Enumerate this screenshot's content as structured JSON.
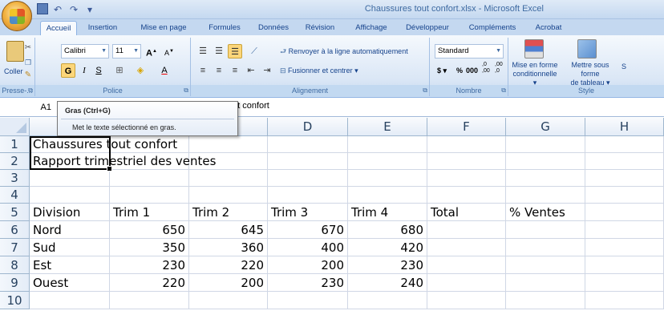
{
  "window": {
    "title": "Chaussures tout confort.xlsx - Microsoft Excel"
  },
  "quick_access": [
    "save-icon",
    "undo-icon",
    "redo-icon",
    "customize-icon"
  ],
  "tabs": [
    "Accueil",
    "Insertion",
    "Mise en page",
    "Formules",
    "Données",
    "Révision",
    "Affichage",
    "Développeur",
    "Compléments",
    "Acrobat"
  ],
  "active_tab": "Accueil",
  "ribbon": {
    "clipboard": {
      "label": "Presse-...",
      "paste": "Coller"
    },
    "font": {
      "label": "Police",
      "name": "Calibri",
      "size": "11",
      "bold": "G",
      "italic": "I",
      "underline": "S"
    },
    "alignment": {
      "label": "Alignement",
      "wrap": "Renvoyer à la ligne automatiquement",
      "merge": "Fusionner et centrer"
    },
    "number": {
      "label": "Nombre",
      "format": "Standard",
      "currency": "$",
      "percent": "%",
      "thousands": "000",
      "inc_decimal": ",0 ,00",
      "dec_decimal": ",00 ,0"
    },
    "style": {
      "label": "Style",
      "cond_format_line1": "Mise en forme",
      "cond_format_line2": "conditionnelle",
      "table_format_line1": "Mettre sous forme",
      "table_format_line2": "de tableau",
      "cell_styles_partial": "S"
    }
  },
  "formula_bar": {
    "name_box": "A1",
    "formula": "ut confort"
  },
  "tooltip": {
    "title": "Gras (Ctrl+G)",
    "description": "Met le texte sélectionné en gras."
  },
  "columns": [
    "D",
    "E",
    "F",
    "G",
    "H"
  ],
  "rows": [
    "1",
    "2",
    "3",
    "4",
    "5",
    "6",
    "7",
    "8",
    "9",
    "10"
  ],
  "sheet": {
    "a1": "Chaussures tout confort",
    "a2": "Rapport trimestriel des ventes",
    "headers": [
      "Division",
      "Trim 1",
      "Trim 2",
      "Trim 3",
      "Trim 4",
      "Total",
      "% Ventes"
    ],
    "data": [
      {
        "division": "Nord",
        "t1": "650",
        "t2": "645",
        "t3": "670",
        "t4": "680"
      },
      {
        "division": "Sud",
        "t1": "350",
        "t2": "360",
        "t3": "400",
        "t4": "420"
      },
      {
        "division": "Est",
        "t1": "230",
        "t2": "220",
        "t3": "200",
        "t4": "230"
      },
      {
        "division": "Ouest",
        "t1": "220",
        "t2": "200",
        "t3": "230",
        "t4": "240"
      }
    ]
  }
}
